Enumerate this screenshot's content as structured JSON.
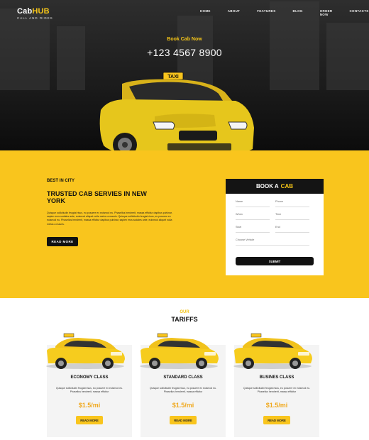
{
  "header": {
    "logo_main_a": "Cab",
    "logo_main_b": "HUB",
    "logo_sub": "CALL AND RIDES",
    "nav": [
      "HOME",
      "ABOUT",
      "FEATURES",
      "BLOG",
      "ORDER NOW",
      "CONTACTS"
    ]
  },
  "hero": {
    "book_label": "Book Cab Now",
    "phone": "+123 4567 8900",
    "taxi_sign": "TAXI"
  },
  "intro": {
    "eyebrow": "BEST IN CITY",
    "title": "TRUSTED CAB SERVIES IN NEW YORK",
    "body": "Quisque sollicitudin feugiat risus, eu posuere ex euismod eu. Phasellus hendrerit, massa efficitur dapibus pulvinar, sapien eros sodales ante, euismod aliquet nulla metus a mauris. Quisque sollicitudin feugiat risus, eu posuere ex euismod eu. Phasellus hendrerit, massa efficitur dapibus pulvinar, sapien eros sodales ante, euismod aliquet nulla metus a mauris.",
    "button": "READ MORE"
  },
  "booking": {
    "title_a": "BOOK A",
    "title_b": "CAB",
    "fields": {
      "name": "Name",
      "phone": "Phone",
      "when": "When",
      "time": "Time",
      "start": "Start",
      "end": "End",
      "vehicle": "Choose Vehicle"
    },
    "submit": "SUBMIT"
  },
  "tariffs": {
    "eyebrow": "OUR",
    "title": "TARIFFS",
    "cards": [
      {
        "name": "ECONOMY CLASS",
        "desc": "Quisque sollicitudin feugiat risus, eu posuere ex euismod eu. Phasellus hendrerit, massa efficitur",
        "price": "$1.5/mi",
        "button": "READ MORE"
      },
      {
        "name": "STANDARD CLASS",
        "desc": "Quisque sollicitudin feugiat risus, eu posuere ex euismod eu. Phasellus hendrerit, massa efficitur",
        "price": "$1.5/mi",
        "button": "READ MORE"
      },
      {
        "name": "BUSINES CLASS",
        "desc": "Quisque sollicitudin feugiat risus, eu posuere ex euismod eu. Phasellus hendrerit, massa efficitur",
        "price": "$1.5/mi",
        "button": "READ MORE"
      }
    ]
  },
  "colors": {
    "accent": "#f9c51d",
    "price": "#f0a81c",
    "dark": "#111111"
  }
}
